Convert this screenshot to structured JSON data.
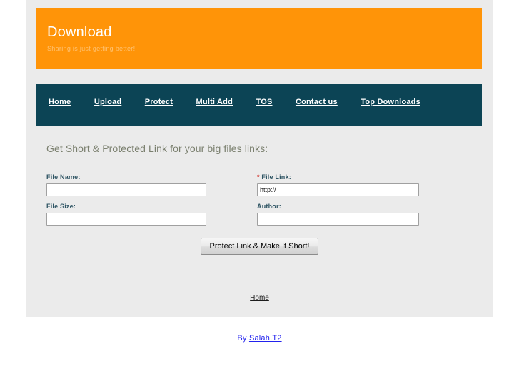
{
  "banner": {
    "title": "Download",
    "tagline": "Sharing is just getting better!",
    "background_color": "#ff9408"
  },
  "nav": {
    "background_color": "#0c4455",
    "items": [
      {
        "label": "Home"
      },
      {
        "label": "Upload"
      },
      {
        "label": "Protect"
      },
      {
        "label": "Multi Add"
      },
      {
        "label": "TOS"
      },
      {
        "label": "Contact us"
      },
      {
        "label": "Top Downloads"
      }
    ]
  },
  "main": {
    "heading": "Get Short & Protected Link for your big files links:",
    "fields": {
      "file_name": {
        "label": "File Name:",
        "value": "",
        "required": false
      },
      "file_size": {
        "label": "File Size:",
        "value": "",
        "required": false
      },
      "file_link": {
        "label": "File Link:",
        "required_marker": "*",
        "value": "http://",
        "required": true
      },
      "author": {
        "label": "Author:",
        "value": "",
        "required": false
      }
    },
    "submit_label": "Protect Link & Make It Short!",
    "bottom_link_label": "Home"
  },
  "footer": {
    "credit_prefix": "By",
    "credit_link_label": "Salah.T2",
    "credit_color": "#2222ee"
  }
}
